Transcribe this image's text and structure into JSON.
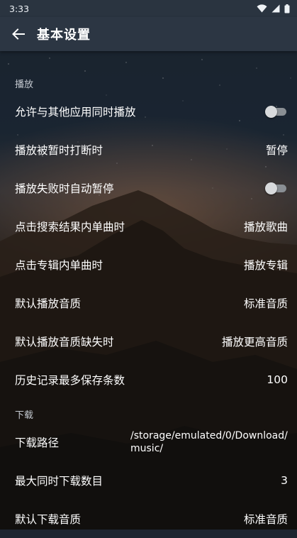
{
  "status_bar": {
    "time": "3:33",
    "icons": [
      "wifi-icon",
      "signal-icon",
      "battery-icon"
    ]
  },
  "app_bar": {
    "title": "基本设置",
    "back_icon": "arrow-left-icon"
  },
  "sections": {
    "playback": {
      "header": "播放",
      "items": [
        {
          "label": "允许与其他应用同时播放",
          "type": "switch",
          "checked": false
        },
        {
          "label": "播放被暂时打断时",
          "value": "暂停"
        },
        {
          "label": "播放失败时自动暂停",
          "type": "switch",
          "checked": false
        },
        {
          "label": "点击搜索结果内单曲时",
          "value": "播放歌曲"
        },
        {
          "label": "点击专辑内单曲时",
          "value": "播放专辑"
        },
        {
          "label": "默认播放音质",
          "value": "标准音质"
        },
        {
          "label": "默认播放音质缺失时",
          "value": "播放更高音质"
        },
        {
          "label": "历史记录最多保存条数",
          "value": "100"
        }
      ]
    },
    "download": {
      "header": "下载",
      "items": [
        {
          "label": "下载路径",
          "value": "/storage/emulated/0/Download/music/"
        },
        {
          "label": "最大同时下载数目",
          "value": "3"
        },
        {
          "label": "默认下载音质",
          "value": "标准音质"
        }
      ]
    }
  },
  "colors": {
    "status_bar_bg": "#2a3440",
    "app_bar_bg": "#2c3643",
    "switch_off_track": "#8a8f94",
    "switch_off_thumb": "#d8dadc"
  }
}
